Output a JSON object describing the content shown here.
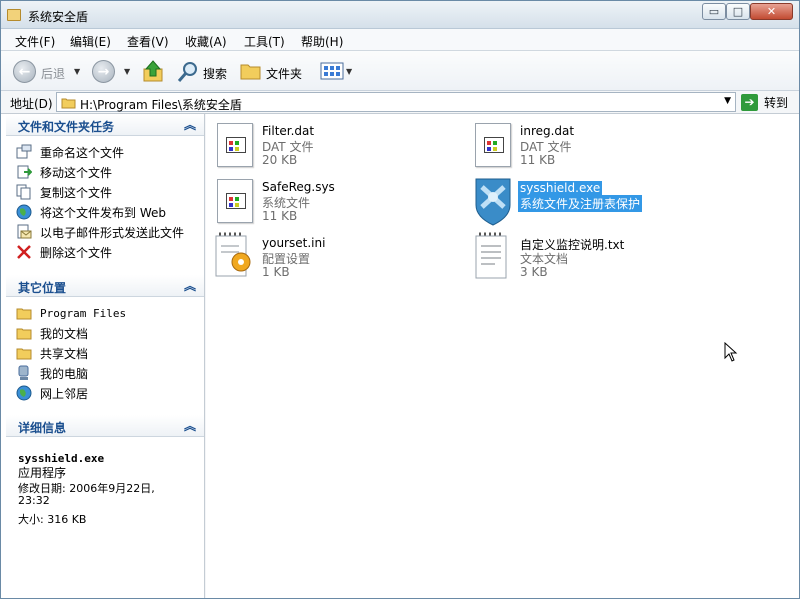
{
  "window": {
    "title": "系统安全盾",
    "min_glyph": "▭",
    "max_glyph": "□",
    "close_glyph": "✕"
  },
  "menu": [
    "文件(F)",
    "编辑(E)",
    "查看(V)",
    "收藏(A)",
    "工具(T)",
    "帮助(H)"
  ],
  "toolbar": {
    "back_label": "后退",
    "search_label": "搜索",
    "folders_label": "文件夹"
  },
  "address": {
    "label": "地址(D)",
    "path": "H:\\Program Files\\系统安全盾",
    "go_label": "转到"
  },
  "sidebar": {
    "tasks_title": "文件和文件夹任务",
    "tasks": [
      "重命名这个文件",
      "移动这个文件",
      "复制这个文件",
      "将这个文件发布到 Web",
      "以电子邮件形式发送此文件",
      "删除这个文件"
    ],
    "places_title": "其它位置",
    "places": [
      "Program Files",
      "我的文档",
      "共享文档",
      "我的电脑",
      "网上邻居"
    ],
    "details_title": "详细信息",
    "details": {
      "name": "sysshield.exe",
      "kind": "应用程序",
      "modified_line1": "修改日期: 2006年9月22日,",
      "modified_line2": "23:32",
      "size": "大小: 316 KB"
    }
  },
  "files": [
    {
      "name": "Filter.dat",
      "type": "DAT 文件",
      "size": "20 KB",
      "icon": "dat-file-icon"
    },
    {
      "name": "inreg.dat",
      "type": "DAT 文件",
      "size": "11 KB",
      "icon": "dat-file-icon"
    },
    {
      "name": "SafeReg.sys",
      "type": "系统文件",
      "size": "11 KB",
      "icon": "sys-file-icon"
    },
    {
      "name": "sysshield.exe",
      "type": "系统文件及注册表保护",
      "size": "",
      "icon": "shield-exe-icon"
    },
    {
      "name": "yourset.ini",
      "type": "配置设置",
      "size": "1 KB",
      "icon": "ini-config-icon"
    },
    {
      "name": "自定义监控说明.txt",
      "type": "文本文档",
      "size": "3 KB",
      "icon": "text-document-icon"
    }
  ],
  "colors": {
    "selection": "#3398e6",
    "panel_title": "#1b4f8f",
    "delete_icon": "#d02020"
  }
}
